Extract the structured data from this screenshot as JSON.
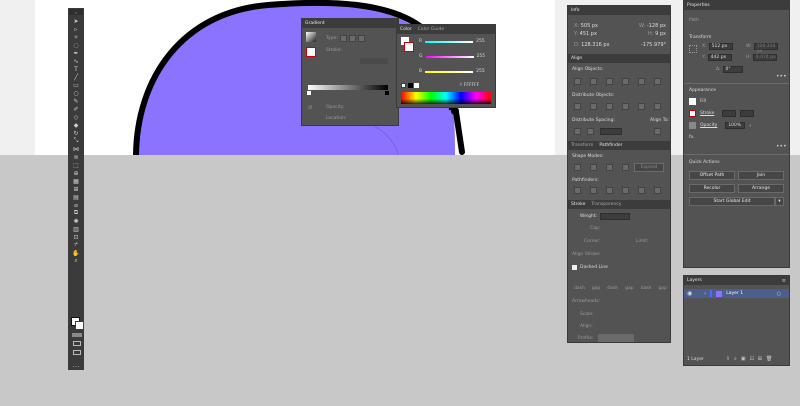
{
  "info": {
    "tab": "Info",
    "x_label": "X:",
    "x": "505 px",
    "y_label": "Y:",
    "y": "451 px",
    "w_label": "W:",
    "w": "-128 px",
    "h_label": "H:",
    "h": "9 px",
    "d_label": "D:",
    "d": "128.316 px",
    "angle": "-175.979°"
  },
  "align": {
    "tab": "Align",
    "align_objects": "Align Objects:",
    "distribute_objects": "Distribute Objects:",
    "distribute_spacing": "Distribute Spacing:",
    "align_to": "Align To:"
  },
  "pathfinder": {
    "tabs": [
      "Transform",
      "Pathfinder"
    ],
    "shape_modes": "Shape Modes:",
    "expand": "Expand",
    "pathfinders": "Pathfinders:"
  },
  "stroke": {
    "tabs": [
      "Stroke",
      "Transparency"
    ],
    "weight_label": "Weight:",
    "cap": "Cap:",
    "corner": "Corner:",
    "limit": "Limit:",
    "align_stroke": "Align Stroke:",
    "dashed_line": "Dashed Line",
    "dash_labels": [
      "dash",
      "gap",
      "dash",
      "gap",
      "dash",
      "gap"
    ],
    "arrowheads": "Arrowheads:",
    "scale": "Scale:",
    "align": "Align:",
    "profile": "Profile:"
  },
  "gradient": {
    "tab": "Gradient",
    "type": "Type:",
    "stroke": "Stroke:",
    "opacity": "Opacity:",
    "location": "Location:"
  },
  "color": {
    "tabs": [
      "Color",
      "Color Guide"
    ],
    "r": "R",
    "g": "G",
    "b": "B",
    "r_val": "255",
    "g_val": "255",
    "b_val": "255",
    "hex_label": "#",
    "hex": "FFFFFF"
  },
  "properties": {
    "tab": "Properties",
    "path": "Path",
    "transform": "Transform",
    "x_label": "X:",
    "x": "512 px",
    "y_label": "Y:",
    "y": "442 px",
    "w_label": "W:",
    "w": "128.316 px",
    "h_label": "H:",
    "h": "9.074 px",
    "angle_label": "∆:",
    "angle": "0°",
    "appearance": "Appearance",
    "fill": "Fill",
    "stroke": "Stroke",
    "opacity": "Opacity",
    "opacity_val": "100%",
    "fx": "fx.",
    "quick_actions": "Quick Actions",
    "offset_path": "Offset Path",
    "join": "Join",
    "recolor": "Recolor",
    "arrange": "Arrange",
    "start_global_edit": "Start Global Edit"
  },
  "layers": {
    "tab": "Layers",
    "layer_name": "Layer 1",
    "count": "1 Layer"
  },
  "toolbar": {
    "tools": [
      "selection-tool",
      "direct-selection-tool",
      "magic-wand-tool",
      "lasso-tool",
      "pen-tool",
      "curvature-tool",
      "type-tool",
      "line-tool",
      "rectangle-tool",
      "ellipse-tool",
      "paintbrush-tool",
      "pencil-tool",
      "shaper-tool",
      "eraser-tool",
      "rotate-tool",
      "scale-tool",
      "width-tool",
      "warp-tool",
      "free-transform-tool",
      "shape-builder-tool",
      "perspective-grid-tool",
      "mesh-tool",
      "gradient-tool",
      "eyedropper-tool",
      "blend-tool",
      "symbol-sprayer-tool",
      "column-graph-tool",
      "artboard-tool",
      "slice-tool",
      "hand-tool",
      "zoom-tool"
    ],
    "more": "..."
  },
  "colors": {
    "shape_fill": "#8c73ff",
    "shape_stroke": "#000000",
    "panel_bg": "#535353",
    "panel_header": "#3c3c3c",
    "layer_color": "#4a6cff",
    "canvas_bg": "#c8c8c8"
  }
}
